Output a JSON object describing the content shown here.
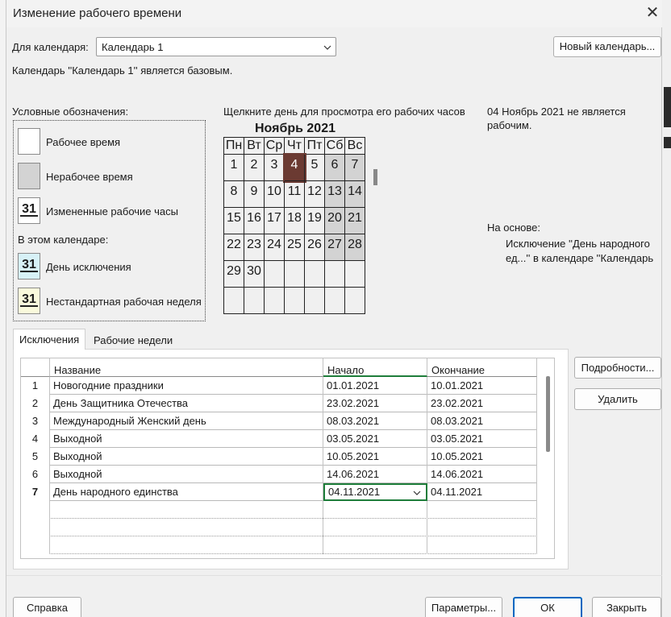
{
  "window": {
    "title": "Изменение рабочего времени",
    "close_glyph": "✕"
  },
  "calendar_select": {
    "label": "Для календаря:",
    "value": "Календарь 1",
    "new_calendar_button": "Новый календарь..."
  },
  "base_info": "Календарь ''Календарь 1'' является базовым.",
  "legend": {
    "title": "Условные обозначения:",
    "items": [
      {
        "label": "Рабочее время"
      },
      {
        "label": "Нерабочее время"
      },
      {
        "label": "Измененные рабочие часы",
        "num": "31"
      }
    ],
    "section_label": "В этом календаре:",
    "calendar_items": [
      {
        "label": "День исключения",
        "num": "31"
      },
      {
        "label": "Нестандартная рабочая неделя",
        "num": "31"
      }
    ]
  },
  "calendar": {
    "hint": "Щелкните день для просмотра его рабочих часов",
    "month_title": "Ноябрь 2021",
    "weekdays": [
      "Пн",
      "Вт",
      "Ср",
      "Чт",
      "Пт",
      "Сб",
      "Вс"
    ],
    "weeks": [
      [
        "1",
        "2",
        "3",
        "4",
        "5",
        "6",
        "7"
      ],
      [
        "8",
        "9",
        "10",
        "11",
        "12",
        "13",
        "14"
      ],
      [
        "15",
        "16",
        "17",
        "18",
        "19",
        "20",
        "21"
      ],
      [
        "22",
        "23",
        "24",
        "25",
        "26",
        "27",
        "28"
      ],
      [
        "29",
        "30",
        "",
        "",
        "",
        "",
        ""
      ],
      [
        "",
        "",
        "",
        "",
        "",
        "",
        ""
      ]
    ],
    "selected_day": "4",
    "day_status_line1": "04 Ноябрь 2021 не является",
    "day_status_line2": "рабочим.",
    "based_on_label": "На основе:",
    "based_on_line1": "Исключение ''День народного",
    "based_on_line2": "ед...'' в календаре ''Календарь"
  },
  "tabs": [
    {
      "label": "Исключения",
      "active": true
    },
    {
      "label": "Рабочие недели",
      "active": false
    }
  ],
  "exceptions_table": {
    "columns": [
      "Название",
      "Начало",
      "Окончание"
    ],
    "rows": [
      {
        "n": "1",
        "name": "Новогодние праздники",
        "start": "01.01.2021",
        "end": "10.01.2021"
      },
      {
        "n": "2",
        "name": "День Защитника Отечества",
        "start": "23.02.2021",
        "end": "23.02.2021"
      },
      {
        "n": "3",
        "name": "Международный Женский день",
        "start": "08.03.2021",
        "end": "08.03.2021"
      },
      {
        "n": "4",
        "name": "Выходной",
        "start": "03.05.2021",
        "end": "03.05.2021"
      },
      {
        "n": "5",
        "name": "Выходной",
        "start": "10.05.2021",
        "end": "10.05.2021"
      },
      {
        "n": "6",
        "name": "Выходной",
        "start": "14.06.2021",
        "end": "14.06.2021"
      },
      {
        "n": "7",
        "name": "День народного единства",
        "start": "04.11.2021",
        "end": "04.11.2021"
      }
    ]
  },
  "side_buttons": {
    "details": "Подробности...",
    "delete": "Удалить"
  },
  "footer": {
    "help": "Справка",
    "options": "Параметры...",
    "ok": "ОК",
    "close": "Закрыть"
  }
}
